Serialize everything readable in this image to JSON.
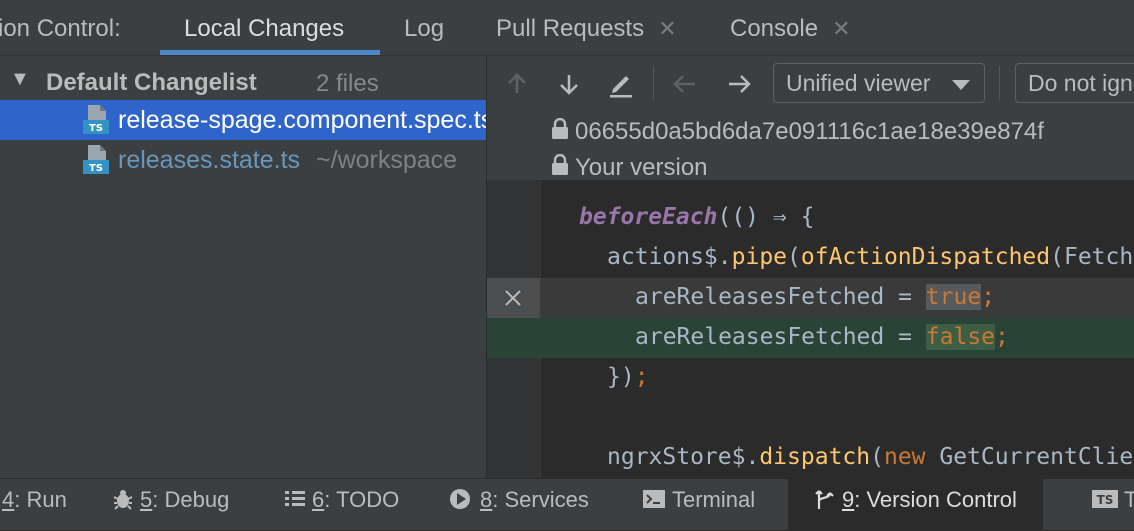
{
  "tabs": {
    "prefix": "sion Control:",
    "items": [
      {
        "label": "Local Changes",
        "closable": false,
        "active": true
      },
      {
        "label": "Log",
        "closable": false
      },
      {
        "label": "Pull Requests",
        "closable": true
      },
      {
        "label": "Console",
        "closable": true
      }
    ],
    "close_glyph": "✕"
  },
  "changelist": {
    "name": "Default Changelist",
    "count": "2 files",
    "files": [
      {
        "name": "release-spage.component.spec.ts",
        "path": "",
        "selected": true,
        "icon": "typescript-file-icon"
      },
      {
        "name": "releases.state.ts",
        "path": "~/workspace",
        "selected": false,
        "icon": "typescript-file-icon"
      }
    ]
  },
  "diff": {
    "viewer_label": "Unified viewer",
    "ignore_label": "Do not ignore",
    "left_revision": "06655d0a5bd6da7e091116c1ae18e39e874f",
    "right_revision": "Your version",
    "code": {
      "line1": {
        "fn": "beforeEach",
        "rest": "(() ⇒ {"
      },
      "line2": {
        "obj": "actions$.",
        "method": "pipe",
        "open": "(",
        "fn": "ofActionDispatched",
        "rest": "(Fetch"
      },
      "line3": {
        "name": "areReleasesFetched",
        "op": " = ",
        "value": "true",
        "end": ";"
      },
      "line4": {
        "name": "areReleasesFetched",
        "op": " = ",
        "value": "false",
        "end": ";"
      },
      "line5": {
        "close": "})",
        "end": ";"
      },
      "line7": {
        "obj": "ngrxStore$.",
        "method": "dispatch",
        "open": "(",
        "kw": "new",
        "rest": " GetCurrentClie"
      }
    }
  },
  "bottom_bar": [
    {
      "num": "4",
      "label": ": Run",
      "icon": "run-icon"
    },
    {
      "num": "5",
      "label": ": Debug",
      "icon": "bug-icon"
    },
    {
      "num": "6",
      "label": ": TODO",
      "icon": "todo-list-icon"
    },
    {
      "num": "8",
      "label": ": Services",
      "icon": "services-icon"
    },
    {
      "num": "",
      "label": "Terminal",
      "icon": "terminal-icon"
    },
    {
      "num": "9",
      "label": ": Version Control",
      "icon": "vcs-branch-icon",
      "active": true
    },
    {
      "num": "",
      "label": "T",
      "icon": "typescript-icon"
    }
  ],
  "colors": {
    "accent": "#4a88c7",
    "selection": "#2f65ca",
    "added_bg": "#294436",
    "modified_file": "#6897bb"
  }
}
